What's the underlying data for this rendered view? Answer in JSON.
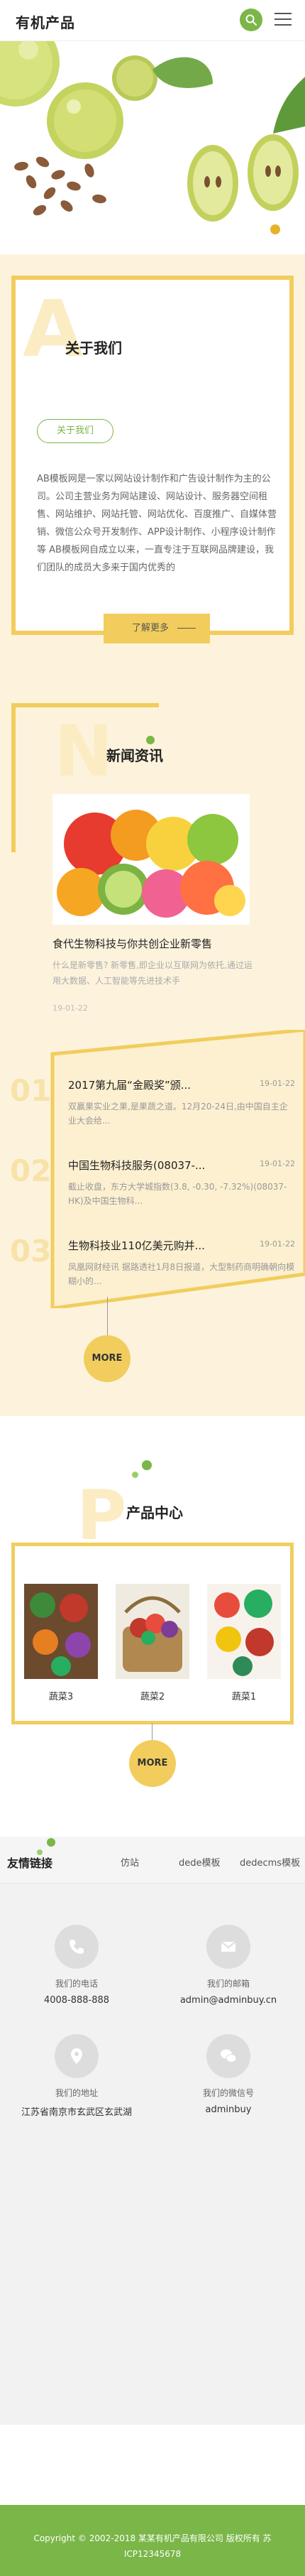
{
  "header": {
    "logo": "有机产品",
    "search_icon": "search-icon",
    "menu_icon": "menu-icon"
  },
  "about": {
    "letter": "A",
    "title": "关于我们",
    "button": "关于我们",
    "text": "AB模板网是一家以网站设计制作和广告设计制作为主的公司。公司主营业务为网站建设、网站设计、服务器空间租售、网站维护、网站托管、网站优化、百度推广、自媒体营销、微信公众号开发制作、APP设计制作、小程序设计制作等 AB模板网自成立以来，一直专注于互联网品牌建设，我们团队的成员大多来于国内优秀的",
    "more": "了解更多"
  },
  "news": {
    "letter": "N",
    "title": "新闻资讯",
    "feature": {
      "title": "食代生物科技与你共创企业新零售",
      "desc": "什么是新零售? 新零售,即企业以互联网为依托,通过运用大数据、人工智能等先进技术手",
      "date": "19-01-22"
    },
    "items": [
      {
        "num": "01",
        "title": "2017第九届“金殿奖”颁...",
        "date": "19-01-22",
        "summary": "双赢果实业之果,是果蔬之道。12月20-24日,由中国自主企业大会给..."
      },
      {
        "num": "02",
        "title": "中国生物科技服务(08037-...",
        "date": "19-01-22",
        "summary": "截止收盘，东方大学城指数(3.8, -0.30, -7.32%)(08037-HK)及中国生物科..."
      },
      {
        "num": "03",
        "title": "生物科技业110亿美元购并...",
        "date": "19-01-22",
        "summary": "凤凰网财经讯 据路透社1月8日报道，大型制药商明确朝向模糊小的..."
      }
    ],
    "more": "MORE"
  },
  "products": {
    "letter": "P",
    "title": "产品中心",
    "items": [
      {
        "name": "蔬菜3"
      },
      {
        "name": "蔬菜2"
      },
      {
        "name": "蔬菜1"
      }
    ],
    "more": "MORE"
  },
  "links": {
    "title": "友情链接",
    "items": [
      "仿站",
      "dede模板",
      "dedecms模板"
    ]
  },
  "contact": {
    "phone": {
      "icon": "phone-icon",
      "label": "我们的电话",
      "value": "4008-888-888"
    },
    "email": {
      "icon": "mail-icon",
      "label": "我们的邮箱",
      "value": "admin@adminbuy.cn"
    },
    "address": {
      "icon": "location-icon",
      "label": "我们的地址",
      "value": "江苏省南京市玄武区玄武湖"
    },
    "wechat": {
      "icon": "wechat-icon",
      "label": "我们的微信号",
      "value": "adminbuy"
    }
  },
  "footer": {
    "copyright": "Copyright © 2002-2018 某某有机产品有限公司 版权所有 苏ICP12345678"
  },
  "colors": {
    "green": "#7ab648",
    "yellow": "#f2cd5d",
    "cream": "#fdf3dd"
  }
}
